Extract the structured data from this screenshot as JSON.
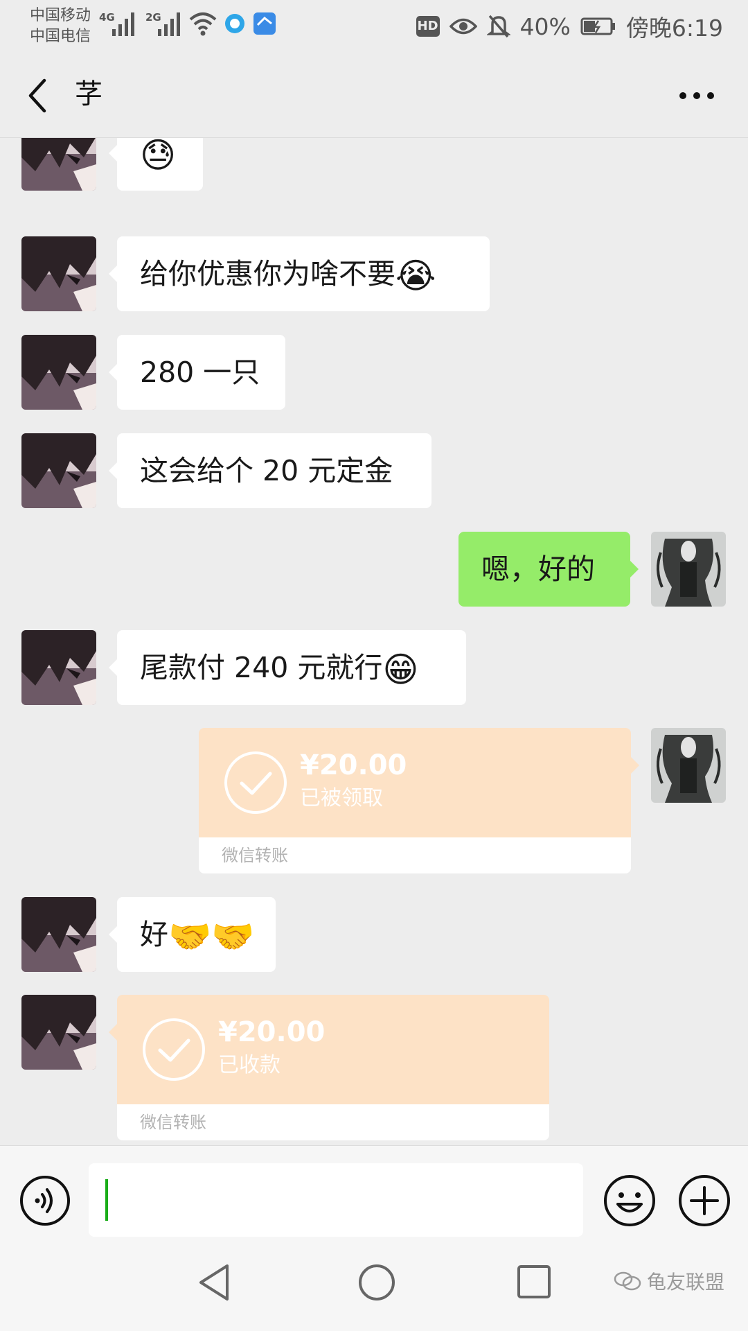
{
  "status_bar": {
    "carrier_1": "中国移动",
    "carrier_2": "中国电信",
    "net_1": "4G",
    "net_2": "2G",
    "hd": "HD",
    "battery": "40%",
    "time": "傍晚6:19"
  },
  "header": {
    "title": "芓"
  },
  "messages": [
    {
      "side": "left",
      "text": "",
      "emoji": "😓"
    },
    {
      "side": "left",
      "text": "给你优惠你为啥不要",
      "emoji": "😭"
    },
    {
      "side": "left",
      "text": "280 一只"
    },
    {
      "side": "left",
      "text": "这会给个 20 元定金"
    },
    {
      "side": "right",
      "text": "嗯，好的"
    },
    {
      "side": "left",
      "text": "尾款付 240 元就行",
      "emoji": "😁"
    },
    {
      "side": "right",
      "type": "transfer",
      "amount": "¥20.00",
      "status": "已被领取",
      "label": "微信转账"
    },
    {
      "side": "left",
      "text": "好",
      "emoji": "🤝🤝"
    },
    {
      "side": "left",
      "type": "transfer",
      "amount": "¥20.00",
      "status": "已收款",
      "label": "微信转账"
    }
  ],
  "footer": {
    "watermark": "龟友联盟"
  },
  "colors": {
    "background": "#ededed",
    "sent_bubble": "#95ec69",
    "received_bubble": "#ffffff",
    "transfer_card": "#fde2c6",
    "cursor": "#1aad19"
  }
}
